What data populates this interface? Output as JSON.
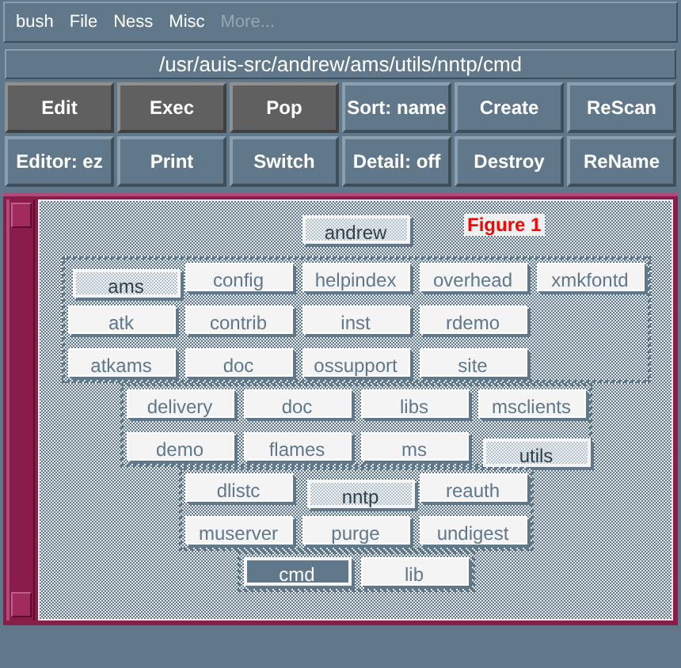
{
  "menu_bar": [
    {
      "label": "bush",
      "disabled": false
    },
    {
      "label": "File",
      "disabled": false
    },
    {
      "label": "Ness",
      "disabled": false
    },
    {
      "label": "Misc",
      "disabled": false
    },
    {
      "label": "More...",
      "disabled": true
    }
  ],
  "path": "/usr/auis-src/andrew/ams/utils/nntp/cmd",
  "buttons": [
    {
      "label": "Edit",
      "dark": true
    },
    {
      "label": "Exec",
      "dark": true
    },
    {
      "label": "Pop",
      "dark": true
    },
    {
      "label": "Sort: name",
      "dark": false
    },
    {
      "label": "Create",
      "dark": false
    },
    {
      "label": "ReScan",
      "dark": false
    },
    {
      "label": "Editor: ez",
      "dark": false
    },
    {
      "label": "Print",
      "dark": false
    },
    {
      "label": "Switch",
      "dark": false
    },
    {
      "label": "Detail: off",
      "dark": false
    },
    {
      "label": "Destroy",
      "dark": false
    },
    {
      "label": "ReName",
      "dark": false
    }
  ],
  "figure_label": "Figure 1",
  "tree": {
    "label": "andrew",
    "on_path": true,
    "selected": false,
    "children": [
      {
        "label": "ams",
        "on_path": true,
        "selected": false,
        "children": [
          {
            "label": "delivery",
            "on_path": false,
            "selected": false
          },
          {
            "label": "demo",
            "on_path": false,
            "selected": false
          },
          {
            "label": "doc",
            "on_path": false,
            "selected": false
          },
          {
            "label": "flames",
            "on_path": false,
            "selected": false
          },
          {
            "label": "libs",
            "on_path": false,
            "selected": false
          },
          {
            "label": "ms",
            "on_path": false,
            "selected": false
          },
          {
            "label": "msclients",
            "on_path": false,
            "selected": false
          },
          {
            "label": "utils",
            "on_path": true,
            "selected": false,
            "children": [
              {
                "label": "dlistc",
                "on_path": false,
                "selected": false
              },
              {
                "label": "muserver",
                "on_path": false,
                "selected": false
              },
              {
                "label": "nntp",
                "on_path": true,
                "selected": false,
                "children": [
                  {
                    "label": "cmd",
                    "on_path": false,
                    "selected": true
                  },
                  {
                    "label": "lib",
                    "on_path": false,
                    "selected": false
                  }
                ]
              },
              {
                "label": "purge",
                "on_path": false,
                "selected": false
              },
              {
                "label": "reauth",
                "on_path": false,
                "selected": false
              },
              {
                "label": "undigest",
                "on_path": false,
                "selected": false
              }
            ]
          }
        ]
      },
      {
        "label": "atk",
        "on_path": false,
        "selected": false
      },
      {
        "label": "atkams",
        "on_path": false,
        "selected": false
      },
      {
        "label": "config",
        "on_path": false,
        "selected": false
      },
      {
        "label": "contrib",
        "on_path": false,
        "selected": false
      },
      {
        "label": "doc",
        "on_path": false,
        "selected": false
      },
      {
        "label": "helpindex",
        "on_path": false,
        "selected": false
      },
      {
        "label": "inst",
        "on_path": false,
        "selected": false
      },
      {
        "label": "ossupport",
        "on_path": false,
        "selected": false
      },
      {
        "label": "overhead",
        "on_path": false,
        "selected": false
      },
      {
        "label": "rdemo",
        "on_path": false,
        "selected": false
      },
      {
        "label": "site",
        "on_path": false,
        "selected": false
      },
      {
        "label": "xmkfontd",
        "on_path": false,
        "selected": false
      }
    ]
  }
}
